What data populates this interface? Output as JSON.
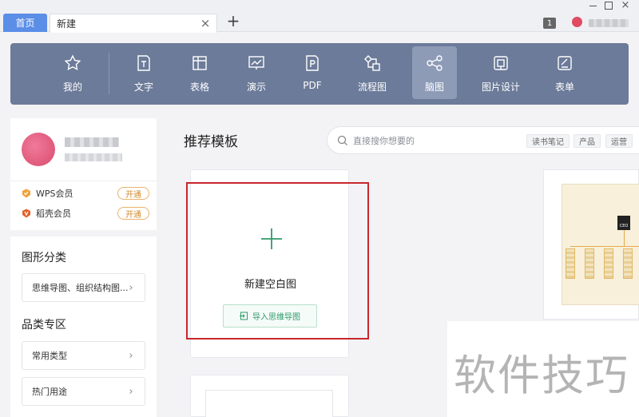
{
  "tabs": {
    "home": "首页",
    "current": "新建",
    "close_glyph": "×",
    "add_glyph": "+"
  },
  "window": {
    "badge": "1",
    "close_glyph": "×"
  },
  "toolbar": {
    "items": [
      {
        "label": "我的",
        "icon": "star-icon"
      },
      {
        "label": "文字",
        "icon": "document-icon"
      },
      {
        "label": "表格",
        "icon": "table-icon"
      },
      {
        "label": "演示",
        "icon": "presentation-icon"
      },
      {
        "label": "PDF",
        "icon": "pdf-icon"
      },
      {
        "label": "流程图",
        "icon": "flowchart-icon"
      },
      {
        "label": "脑图",
        "icon": "mindmap-icon",
        "active": true
      },
      {
        "label": "图片设计",
        "icon": "image-design-icon"
      },
      {
        "label": "表单",
        "icon": "form-icon"
      }
    ],
    "bg_color": "#6c7b99",
    "active_color": "#8d9bb7"
  },
  "profile": {
    "memberships": [
      {
        "label": "WPS会员",
        "action": "开通"
      },
      {
        "label": "稻壳会员",
        "action": "开通"
      }
    ]
  },
  "sidebar": {
    "category_title": "图形分类",
    "category_item": "思维导图、组织结构图...",
    "zone_title": "品类专区",
    "zone_items": [
      "常用类型",
      "热门用途"
    ],
    "chevron": "›"
  },
  "main": {
    "title": "推荐模板",
    "search_placeholder": "直接搜你想要的",
    "tags": [
      "读书笔记",
      "产品",
      "运营"
    ],
    "blank_card": {
      "label": "新建空白图",
      "import_label": "导入思维导图"
    },
    "preview": {
      "ceo_label": "CEO"
    }
  },
  "watermark": "软件技巧",
  "colors": {
    "accent_green": "#2e9a6a",
    "highlight_red": "#c8262c",
    "home_tab_blue": "#5b8ee6"
  }
}
